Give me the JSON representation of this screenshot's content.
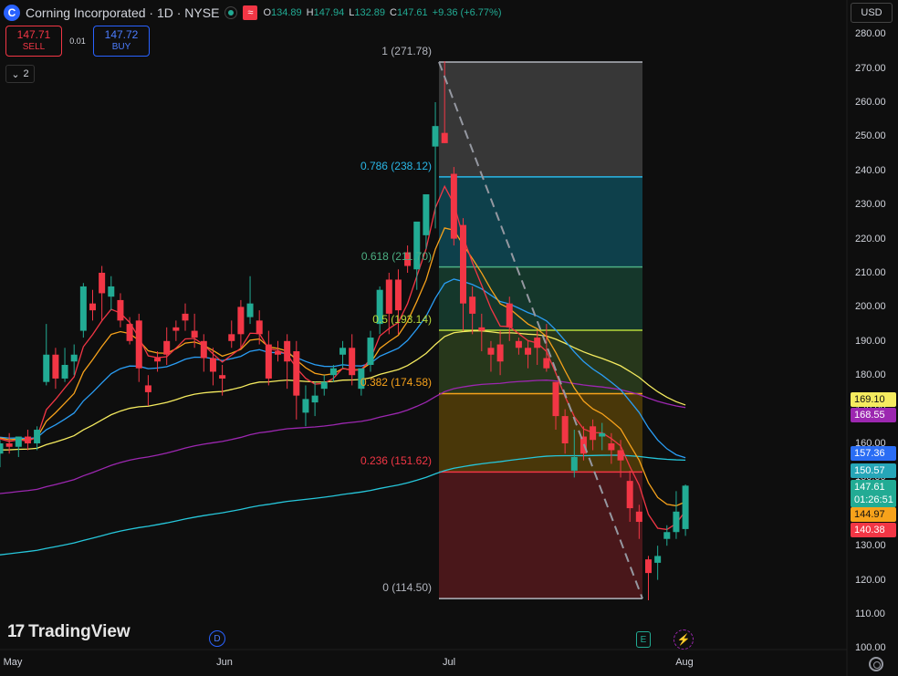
{
  "header": {
    "logo_letter": "C",
    "title": "Corning Incorporated · 1D · NYSE",
    "wave_icon": "≈",
    "ohlc": [
      {
        "k": "O",
        "v": "134.89"
      },
      {
        "k": "H",
        "v": "147.94"
      },
      {
        "k": "L",
        "v": "132.89"
      },
      {
        "k": "C",
        "v": "147.61"
      },
      {
        "k": "",
        "v": "+9.36 (+6.77%)"
      }
    ]
  },
  "trade": {
    "sell_price": "147.71",
    "sell_label": "SELL",
    "spread": "0.01",
    "buy_price": "147.72",
    "buy_label": "BUY"
  },
  "collapse": {
    "count": "2"
  },
  "currency": "USD",
  "watermark": "TradingView",
  "events": {
    "dividend": "D",
    "earnings": "E",
    "flash": "⚡"
  },
  "colors": {
    "up": "#22ab94",
    "down": "#f23645",
    "ema_fast": "#f23645",
    "ema_mid": "#f7a21b",
    "ema_slow_blue": "#2a9df4",
    "ema_yellow": "#f5eb5f",
    "ema_purple": "#9c27b0",
    "ema_cyan": "#26c6da"
  },
  "x_axis": [
    "May",
    "Jun",
    "Jul",
    "Aug"
  ],
  "y_axis": [
    "280.00",
    "270.00",
    "260.00",
    "250.00",
    "240.00",
    "230.00",
    "220.00",
    "210.00",
    "200.00",
    "190.00",
    "180.00",
    "170.00",
    "160.00",
    "150.00",
    "140.00",
    "130.00",
    "120.00",
    "110.00",
    "100.00"
  ],
  "price_tags": [
    {
      "text": "169.10",
      "bg": "#f5eb5f",
      "dark": true
    },
    {
      "text": "168.55",
      "bg": "#9c27b0",
      "dark": false
    },
    {
      "text": "157.36",
      "bg": "#2a6df4",
      "dark": false
    },
    {
      "text": "150.57",
      "bg": "#26a6b8",
      "dark": false
    },
    {
      "text": "147.61\n01:26:51",
      "bg": "#22ab94",
      "dark": false
    },
    {
      "text": "144.97",
      "bg": "#f7a21b",
      "dark": true
    },
    {
      "text": "140.38",
      "bg": "#f23645",
      "dark": false
    }
  ],
  "fib_levels": [
    {
      "label": "1 (271.78)",
      "color": "#b2b5be"
    },
    {
      "label": "0.786 (238.12)",
      "color": "#2ab7e6"
    },
    {
      "label": "0.618 (211.70)",
      "color": "#4caf83"
    },
    {
      "label": "0.5 (193.14)",
      "color": "#b6d93a"
    },
    {
      "label": "0.382 (174.58)",
      "color": "#f7a21b"
    },
    {
      "label": "0.236 (151.62)",
      "color": "#f23645"
    },
    {
      "label": "0 (114.50)",
      "color": "#b2b5be"
    }
  ],
  "chart_data": {
    "type": "candlestick",
    "ylim": [
      100,
      280
    ],
    "x_ticks": [
      "May",
      "Jun",
      "Jul",
      "Aug"
    ],
    "y_ticks": [
      280,
      270,
      260,
      250,
      240,
      230,
      220,
      210,
      200,
      190,
      180,
      170,
      160,
      150,
      140,
      130,
      120,
      110,
      100
    ],
    "last_bar": {
      "open": 134.89,
      "high": 147.94,
      "low": 132.89,
      "close": 147.61
    },
    "fibonacci": [
      {
        "ratio": 1,
        "value": 271.78
      },
      {
        "ratio": 0.786,
        "value": 238.12
      },
      {
        "ratio": 0.618,
        "value": 211.7
      },
      {
        "ratio": 0.5,
        "value": 193.14
      },
      {
        "ratio": 0.382,
        "value": 174.58
      },
      {
        "ratio": 0.236,
        "value": 151.62
      },
      {
        "ratio": 0,
        "value": 114.5
      }
    ],
    "candles": [
      [
        157,
        161,
        153,
        160
      ],
      [
        160,
        163,
        157,
        159
      ],
      [
        159,
        162,
        156,
        162
      ],
      [
        162,
        164,
        158,
        160
      ],
      [
        160,
        165,
        158,
        164
      ],
      [
        178,
        195,
        177,
        186
      ],
      [
        186,
        188,
        176,
        179
      ],
      [
        179,
        188,
        178,
        183
      ],
      [
        184,
        189,
        180,
        186
      ],
      [
        193,
        207,
        191,
        206
      ],
      [
        201,
        205,
        196,
        199
      ],
      [
        210,
        212,
        196,
        204
      ],
      [
        203,
        209,
        199,
        206
      ],
      [
        202,
        204,
        194,
        196
      ],
      [
        195,
        197,
        189,
        190
      ],
      [
        196,
        198,
        178,
        182
      ],
      [
        177,
        180,
        171,
        175
      ],
      [
        185,
        187,
        181,
        184
      ],
      [
        190,
        194,
        183,
        186
      ],
      [
        194,
        196,
        190,
        193
      ],
      [
        198,
        201,
        193,
        196
      ],
      [
        193,
        198,
        188,
        191
      ],
      [
        190,
        192,
        181,
        185
      ],
      [
        185,
        188,
        177,
        181
      ],
      [
        180,
        183,
        174,
        179
      ],
      [
        192,
        196,
        188,
        190
      ],
      [
        200,
        202,
        188,
        192
      ],
      [
        197,
        209,
        195,
        201
      ],
      [
        196,
        199,
        189,
        192
      ],
      [
        189,
        193,
        177,
        179
      ],
      [
        187,
        190,
        184,
        186
      ],
      [
        190,
        192,
        176,
        184
      ],
      [
        187,
        190,
        167,
        174
      ],
      [
        169,
        177,
        165,
        173
      ],
      [
        172,
        178,
        168,
        174
      ],
      [
        176,
        180,
        174,
        178
      ],
      [
        180,
        183,
        178,
        182
      ],
      [
        186,
        190,
        182,
        188
      ],
      [
        188,
        192,
        177,
        180
      ],
      [
        176,
        180,
        174,
        182
      ],
      [
        183,
        193,
        181,
        191
      ],
      [
        195,
        206,
        192,
        205
      ],
      [
        208,
        210,
        192,
        198
      ],
      [
        208,
        211,
        192,
        199
      ],
      [
        216,
        218,
        210,
        212
      ],
      [
        211,
        222,
        205,
        225
      ],
      [
        221,
        233,
        217,
        233
      ],
      [
        247,
        260,
        223,
        253
      ],
      [
        251,
        272,
        248,
        248
      ],
      [
        239,
        241,
        218,
        220
      ],
      [
        224,
        226,
        193,
        201
      ],
      [
        203,
        206,
        192,
        198
      ],
      [
        194,
        198,
        187,
        193
      ],
      [
        188,
        190,
        181,
        186
      ],
      [
        189,
        193,
        180,
        184
      ],
      [
        201,
        203,
        190,
        194
      ],
      [
        190,
        191,
        186,
        188
      ],
      [
        188,
        190,
        182,
        186
      ],
      [
        191,
        193,
        183,
        188
      ],
      [
        185,
        195,
        181,
        182
      ],
      [
        178,
        178,
        164,
        168
      ],
      [
        168,
        170,
        157,
        160
      ],
      [
        152,
        164,
        150,
        156
      ],
      [
        162,
        165,
        155,
        157
      ],
      [
        165,
        167,
        158,
        161
      ],
      [
        162,
        166,
        158,
        163
      ],
      [
        160,
        163,
        154,
        158
      ],
      [
        158,
        161,
        150,
        155
      ],
      [
        149,
        152,
        137,
        141
      ],
      [
        140,
        142,
        132,
        137
      ],
      [
        126,
        127,
        114,
        122
      ],
      [
        125,
        130,
        120,
        127
      ],
      [
        132,
        136,
        130,
        134
      ],
      [
        134,
        146,
        132,
        140
      ],
      [
        134.89,
        147.94,
        132.89,
        147.61
      ]
    ]
  }
}
